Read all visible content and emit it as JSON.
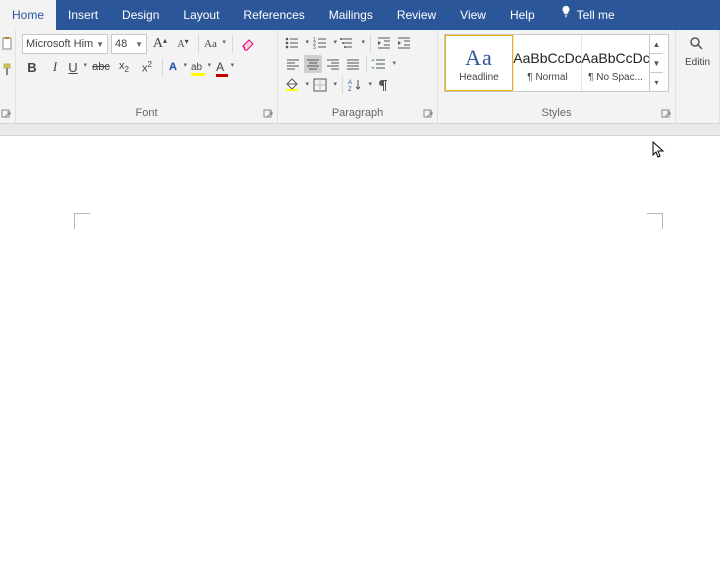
{
  "tabs": [
    "Home",
    "Insert",
    "Design",
    "Layout",
    "References",
    "Mailings",
    "Review",
    "View",
    "Help"
  ],
  "active_tab": 0,
  "tellme": "Tell me",
  "font": {
    "name": "Microsoft Him",
    "size": "48",
    "grow": "A",
    "shrink": "A",
    "case": "Aa",
    "bold": "B",
    "italic": "I",
    "underline": "U",
    "strike": "abc",
    "sub": "x",
    "sub2": "2",
    "sup": "x",
    "sup2": "2",
    "texteffects": "A",
    "highlight": "ab",
    "fontcolor": "A",
    "group": "Font"
  },
  "para": {
    "group": "Paragraph"
  },
  "styles": {
    "items": [
      {
        "preview": "Aa",
        "name": "Headline",
        "big": true
      },
      {
        "preview": "AaBbCcDc",
        "name": "¶ Normal",
        "big": false
      },
      {
        "preview": "AaBbCcDc",
        "name": "¶ No Spac...",
        "big": false
      }
    ],
    "group": "Styles",
    "selected": 0
  },
  "editing": {
    "find": "Editin",
    "group": ""
  }
}
